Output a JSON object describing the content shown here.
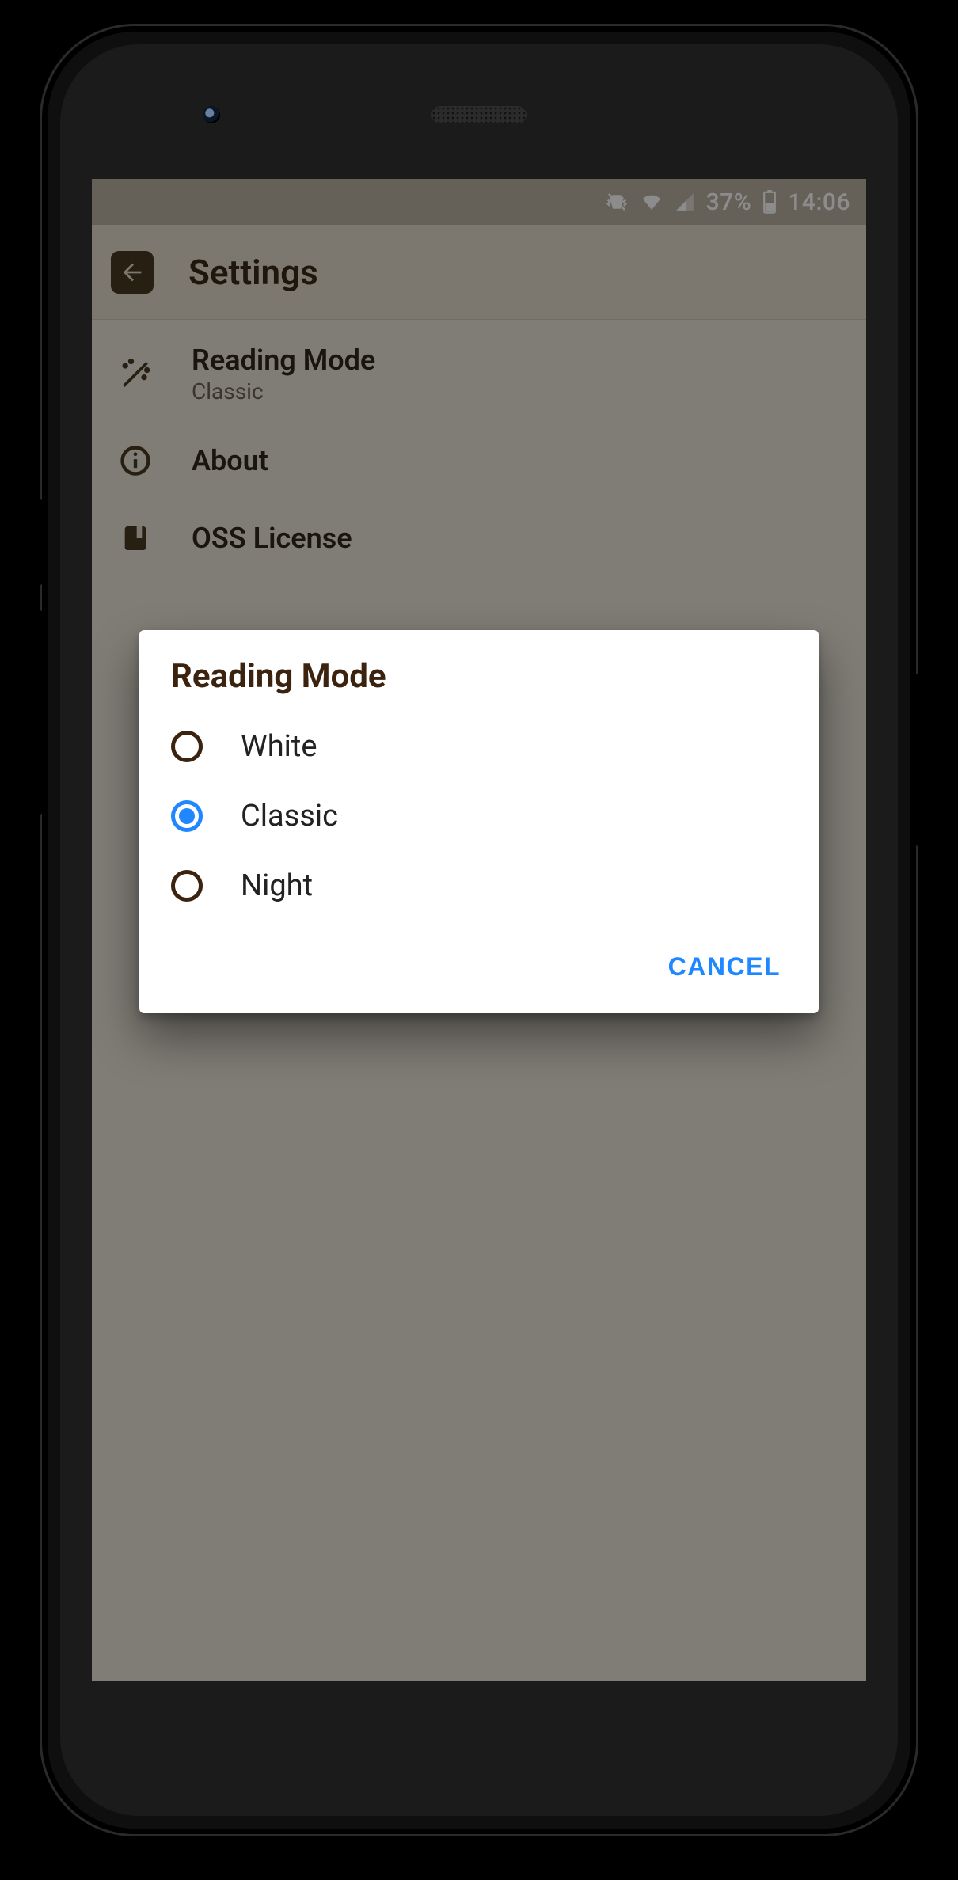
{
  "status_bar": {
    "battery_percent": "37%",
    "time": "14:06",
    "icons": [
      "vibrate",
      "wifi",
      "cell-signal",
      "battery"
    ]
  },
  "appbar": {
    "title": "Settings"
  },
  "settings": {
    "items": [
      {
        "icon": "wand",
        "title": "Reading Mode",
        "subtitle": "Classic"
      },
      {
        "icon": "info",
        "title": "About",
        "subtitle": ""
      },
      {
        "icon": "book",
        "title": "OSS License",
        "subtitle": ""
      }
    ]
  },
  "dialog": {
    "title": "Reading Mode",
    "options": [
      {
        "label": "White",
        "selected": false
      },
      {
        "label": "Classic",
        "selected": true
      },
      {
        "label": "Night",
        "selected": false
      }
    ],
    "cancel": "CANCEL"
  },
  "colors": {
    "accent": "#1f87ff",
    "brown": "#3b2310",
    "page_bg": "#eae4d7"
  }
}
